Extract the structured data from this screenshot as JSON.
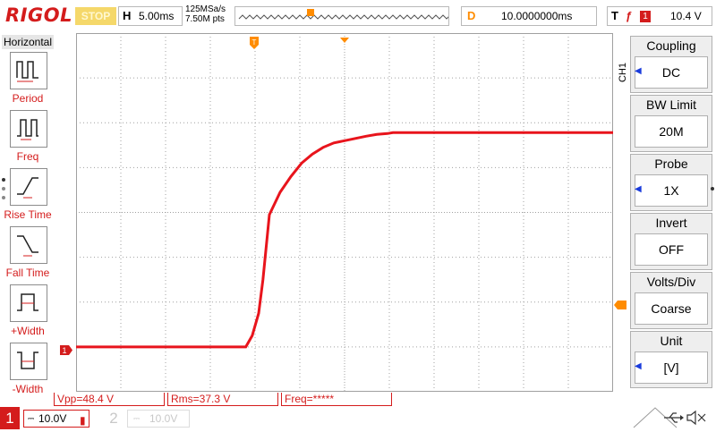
{
  "top_bar": {
    "logo": "RIGOL",
    "run_status": "STOP",
    "horizontal": {
      "label": "H",
      "timebase": "5.00ms"
    },
    "sample_rate": "125MSa/s",
    "memory_depth": "7.50M pts",
    "delay": {
      "label": "D",
      "value": "10.0000000ms"
    },
    "trigger": {
      "label": "T",
      "edge": "ƒ",
      "source": "1",
      "level": "10.4 V"
    }
  },
  "left_menu": {
    "title": "Horizontal",
    "items": [
      {
        "label": "Period",
        "icon": "period-icon"
      },
      {
        "label": "Freq",
        "icon": "frequency-icon"
      },
      {
        "label": "Rise Time",
        "icon": "rise-time-icon"
      },
      {
        "label": "Fall Time",
        "icon": "fall-time-icon"
      },
      {
        "label": "+Width",
        "icon": "positive-width-icon"
      },
      {
        "label": "-Width",
        "icon": "negative-width-icon"
      }
    ]
  },
  "right_menu": {
    "channel_tag": "CH1",
    "items": [
      {
        "title": "Coupling",
        "value": "DC",
        "has_arrow": true
      },
      {
        "title": "BW Limit",
        "value": "20M",
        "has_arrow": false
      },
      {
        "title": "Probe",
        "value": "1X",
        "has_arrow": true
      },
      {
        "title": "Invert",
        "value": "OFF",
        "has_arrow": false
      },
      {
        "title": "Volts/Div",
        "value": "Coarse",
        "has_arrow": false
      },
      {
        "title": "Unit",
        "value": "[V]",
        "has_arrow": true
      }
    ]
  },
  "measurements": [
    {
      "label": "Vpp=48.4 V"
    },
    {
      "label": "Rms=37.3 V"
    },
    {
      "label": "Freq=*****"
    }
  ],
  "channels": [
    {
      "number": "1",
      "scale": "10.0V",
      "active": true
    },
    {
      "number": "2",
      "scale": "10.0V",
      "active": false
    }
  ],
  "markers": {
    "trigger_marker": "T",
    "channel_marker": "1"
  },
  "colors": {
    "ch1": "#e8141c",
    "brand": "#d41c1c",
    "trigger": "#ff8c00",
    "grid": "#a0a0a0"
  },
  "chart_data": {
    "type": "line",
    "title": "",
    "xlabel": "",
    "ylabel": "",
    "xlim": [
      -25,
      25
    ],
    "ylim": [
      -40,
      40
    ],
    "x_divisions": 12,
    "y_divisions": 8,
    "grid": true,
    "series": [
      {
        "x": [
          -25,
          -9.2,
          -8.6,
          -8.0,
          -7.6,
          -7.0,
          -6.0,
          -5.0,
          -4.0,
          -3.0,
          -2.0,
          -1.0,
          0.0,
          1.0,
          2.0,
          3.0,
          4.0,
          4.5,
          25
        ],
        "y": [
          -30.0,
          -30.0,
          -27.5,
          -22.5,
          -15.0,
          -0.5,
          4.5,
          8.0,
          11.0,
          13.0,
          14.5,
          15.5,
          16.0,
          16.5,
          17.0,
          17.4,
          17.6,
          17.8,
          17.8
        ]
      }
    ]
  }
}
